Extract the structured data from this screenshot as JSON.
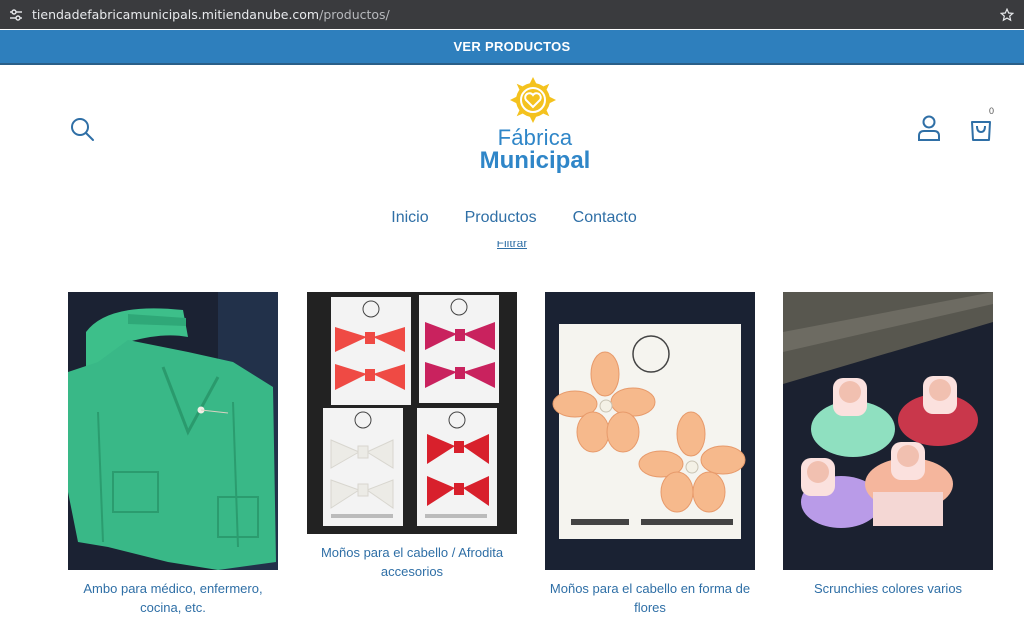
{
  "browser": {
    "url_host": "tiendadefabricamunicipals.mitiendanube.com",
    "url_path": "/productos/"
  },
  "promo": {
    "text": "VER PRODUCTOS"
  },
  "brand": {
    "line1": "Fábrica",
    "line2": "Municipal"
  },
  "cart": {
    "count": "0"
  },
  "nav": {
    "items": [
      "Inicio",
      "Productos",
      "Contacto"
    ]
  },
  "filter": {
    "label": "Filtrar"
  },
  "products": [
    {
      "title": "Ambo para médico, enfermero, cocina, etc."
    },
    {
      "title": "Moños para el cabello / Afrodita accesorios"
    },
    {
      "title": "Moños para el cabello en forma de flores"
    },
    {
      "title": "Scrunchies colores varios"
    }
  ],
  "colors": {
    "promo_bar": "#2e7fbd",
    "brand_blue": "#2f86c8",
    "link_blue": "#2f6fa6",
    "sun_yellow": "#f4c21e"
  },
  "icons": [
    "settings-tune-icon",
    "star-icon",
    "search-icon",
    "sun-logo-icon",
    "user-icon",
    "shopping-bag-icon"
  ]
}
